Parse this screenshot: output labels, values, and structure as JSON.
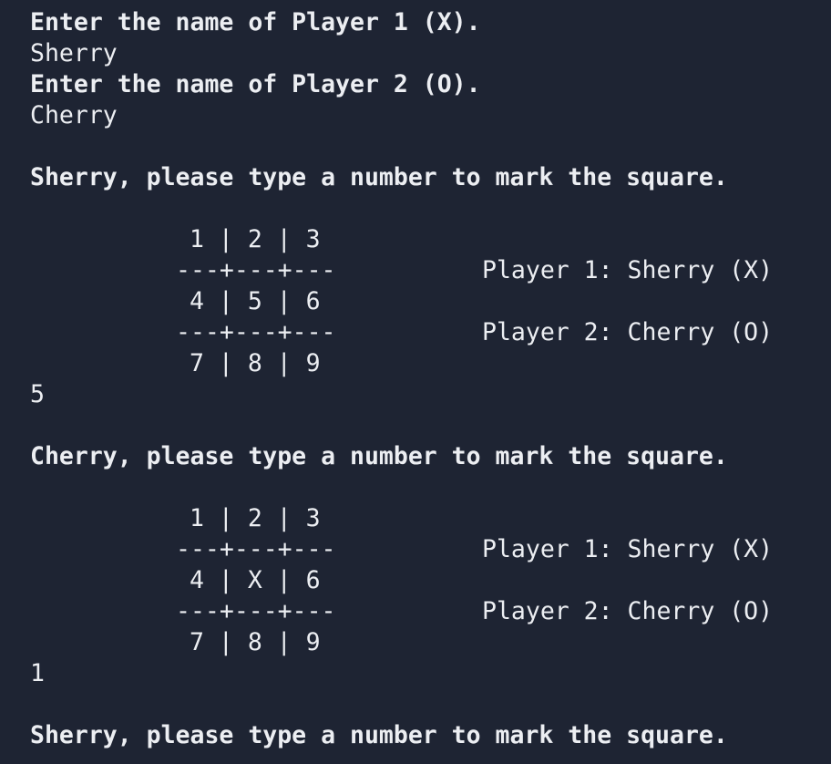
{
  "terminal": {
    "background": "#1e2433",
    "text_color": "#eceef2",
    "lines": {
      "p1_prompt": "Enter the name of Player 1 (X).",
      "p1_input": "Sherry",
      "p2_prompt": "Enter the name of Player 2 (O).",
      "p2_input": "Cherry"
    },
    "turns": [
      {
        "prompt": "Sherry, please type a number to mark the square.",
        "board_rows": [
          "1 | 2 | 3",
          "4 | 5 | 6",
          "7 | 8 | 9"
        ],
        "separator": "---+---+---",
        "player1": "Player 1: Sherry (X)",
        "player2": "Player 2: Cherry (O)",
        "input": "5"
      },
      {
        "prompt": "Cherry, please type a number to mark the square.",
        "board_rows": [
          "1 | 2 | 3",
          "4 | X | 6",
          "7 | 8 | 9"
        ],
        "separator": "---+---+---",
        "player1": "Player 1: Sherry (X)",
        "player2": "Player 2: Cherry (O)",
        "input": "1"
      },
      {
        "prompt": "Sherry, please type a number to mark the square."
      }
    ]
  }
}
